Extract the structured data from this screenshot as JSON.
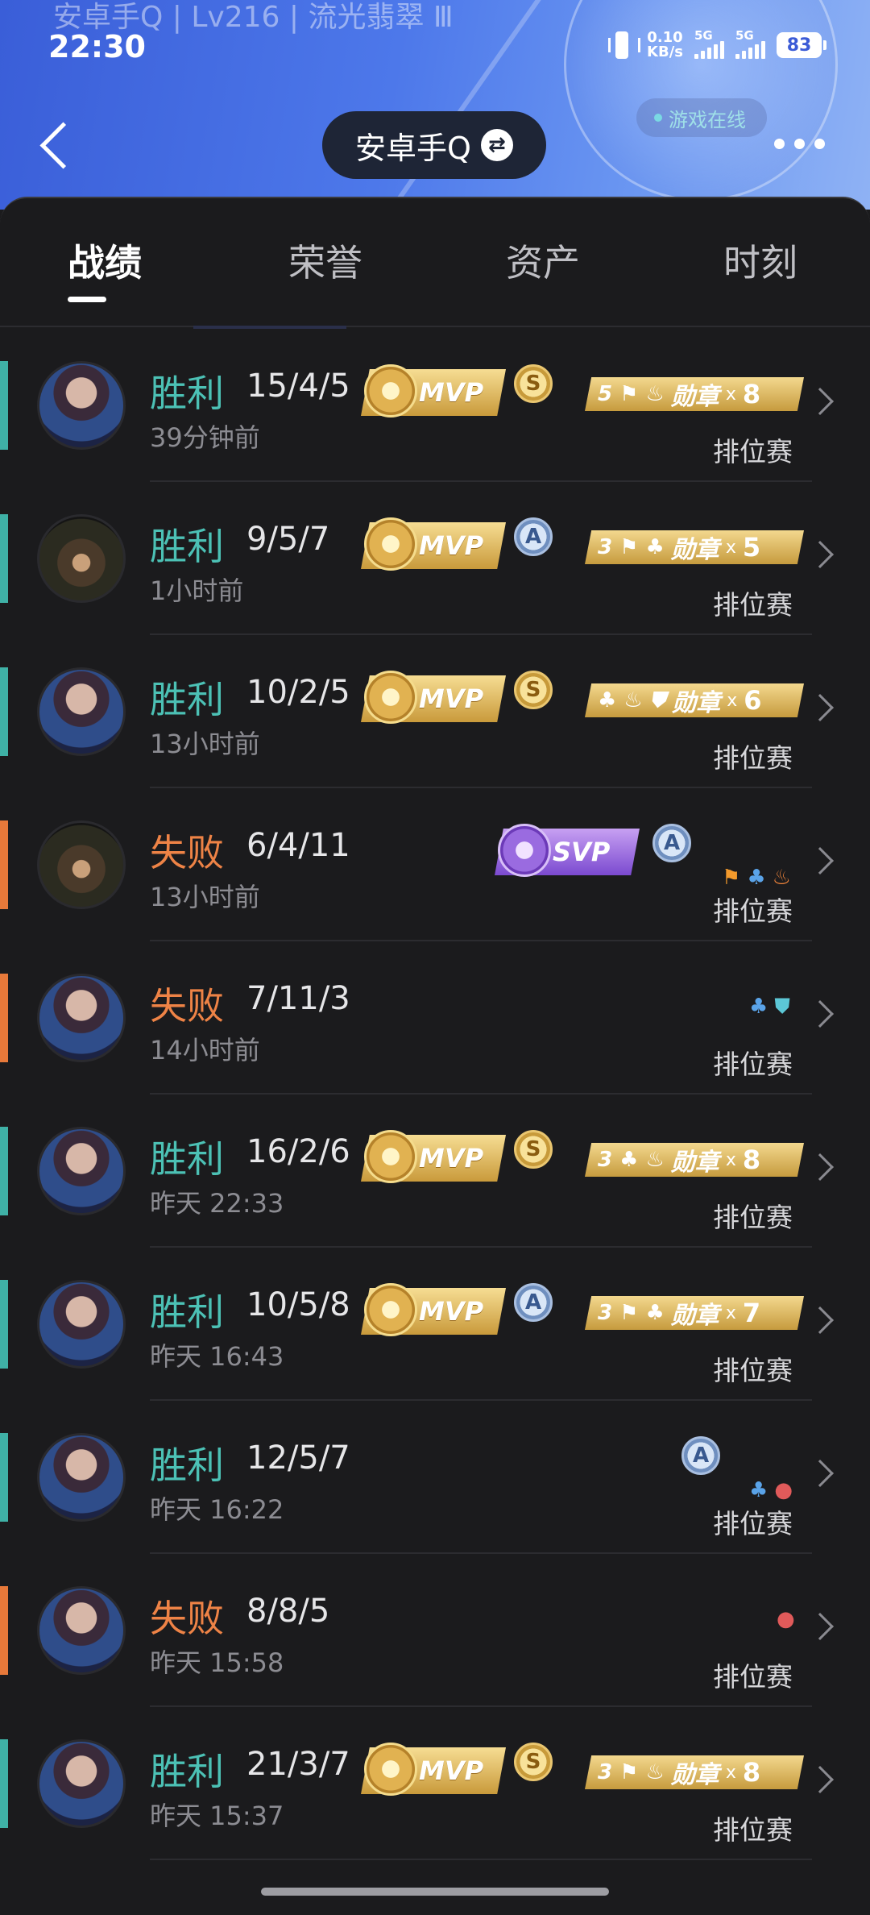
{
  "header": {
    "faded_title": "安卓手Q | Lv216 | 流光翡翠 Ⅲ",
    "account_name": "安卓手Q",
    "online_status": "游戏在线"
  },
  "status_bar": {
    "time": "22:30",
    "net_speed_value": "0.10",
    "net_speed_unit": "KB/s",
    "sim1": "5G",
    "sim2": "5G",
    "battery": "83"
  },
  "tabs": [
    "战绩",
    "荣誉",
    "资产",
    "时刻"
  ],
  "badges": {
    "mvp": "MVP",
    "svp": "SVP",
    "medal_label": "勋章",
    "medal_x": "x"
  },
  "matches": [
    {
      "result": "胜利",
      "outcome": "win",
      "kda": "15/4/5",
      "time": "39分钟前",
      "mode": "排位赛",
      "hero": "yasuo",
      "badge": "mvp",
      "grade": "S",
      "medal_count": "8",
      "medal_glyphs": "5 ⚑ ♨"
    },
    {
      "result": "胜利",
      "outcome": "win",
      "kda": "9/5/7",
      "time": "1小时前",
      "mode": "排位赛",
      "hero": "beast",
      "badge": "mvp",
      "grade": "A",
      "medal_count": "5",
      "medal_glyphs": "3 ⚑ ♣"
    },
    {
      "result": "胜利",
      "outcome": "win",
      "kda": "10/2/5",
      "time": "13小时前",
      "mode": "排位赛",
      "hero": "yasuo",
      "badge": "mvp",
      "grade": "S",
      "medal_count": "6",
      "medal_glyphs": "♣ ♨ ⛊"
    },
    {
      "result": "失败",
      "outcome": "loss",
      "kda": "6/4/11",
      "time": "13小时前",
      "mode": "排位赛",
      "hero": "beast",
      "badge": "svp",
      "grade": "A",
      "medal_count": "",
      "icons": "flag-tri-fire"
    },
    {
      "result": "失败",
      "outcome": "loss",
      "kda": "7/11/3",
      "time": "14小时前",
      "mode": "排位赛",
      "hero": "yasuo",
      "badge": "",
      "grade": "",
      "medal_count": "",
      "icons": "tri-shield"
    },
    {
      "result": "胜利",
      "outcome": "win",
      "kda": "16/2/6",
      "time": "昨天 22:33",
      "mode": "排位赛",
      "hero": "yasuo",
      "badge": "mvp",
      "grade": "S",
      "medal_count": "8",
      "medal_glyphs": "3 ♣ ♨"
    },
    {
      "result": "胜利",
      "outcome": "win",
      "kda": "10/5/8",
      "time": "昨天 16:43",
      "mode": "排位赛",
      "hero": "yasuo",
      "badge": "mvp",
      "grade": "A",
      "medal_count": "7",
      "medal_glyphs": "3 ⚑ ♣"
    },
    {
      "result": "胜利",
      "outcome": "win",
      "kda": "12/5/7",
      "time": "昨天 16:22",
      "mode": "排位赛",
      "hero": "yasuo",
      "badge": "",
      "grade": "A",
      "medal_count": "",
      "icons": "tri-drop"
    },
    {
      "result": "失败",
      "outcome": "loss",
      "kda": "8/8/5",
      "time": "昨天 15:58",
      "mode": "排位赛",
      "hero": "yasuo",
      "badge": "",
      "grade": "",
      "medal_count": "",
      "icons": "drop"
    },
    {
      "result": "胜利",
      "outcome": "win",
      "kda": "21/3/7",
      "time": "昨天 15:37",
      "mode": "排位赛",
      "hero": "yasuo",
      "badge": "mvp",
      "grade": "S",
      "medal_count": "8",
      "medal_glyphs": "3 ⚑ ♨"
    }
  ],
  "colors": {
    "win": "#4cc1b5",
    "loss": "#ee8346",
    "header_blue": "#4d78ea"
  }
}
